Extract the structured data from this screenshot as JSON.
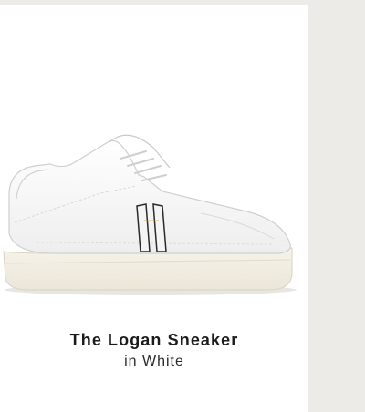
{
  "product": {
    "name": "The Logan Sneaker",
    "color_label": "in White",
    "image_icon": "sneaker-image"
  },
  "colors": {
    "page_background": "#ecebe8",
    "card_background": "#ffffff",
    "text": "#1b1b1b"
  }
}
